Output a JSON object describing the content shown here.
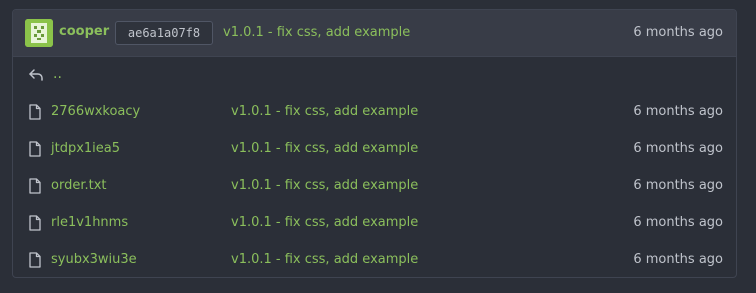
{
  "latest_commit": {
    "author": "cooper",
    "sha": "ae6a1a07f8",
    "message": "v1.0.1 - fix css, add example",
    "time": "6 months ago"
  },
  "parent_dir": {
    "label": "..",
    "icon": "back-arrow-icon"
  },
  "files": [
    {
      "name": "2766wxkoacy",
      "commit": "v1.0.1 - fix css, add example",
      "time": "6 months ago",
      "icon": "file-icon"
    },
    {
      "name": "jtdpx1iea5",
      "commit": "v1.0.1 - fix css, add example",
      "time": "6 months ago",
      "icon": "file-icon"
    },
    {
      "name": "order.txt",
      "commit": "v1.0.1 - fix css, add example",
      "time": "6 months ago",
      "icon": "file-icon"
    },
    {
      "name": "rle1v1hnms",
      "commit": "v1.0.1 - fix css, add example",
      "time": "6 months ago",
      "icon": "file-icon"
    },
    {
      "name": "syubx3wiu3e",
      "commit": "v1.0.1 - fix css, add example",
      "time": "6 months ago",
      "icon": "file-icon"
    }
  ],
  "colors": {
    "link": "#8bbf5c",
    "background": "#2b2f38",
    "header_background": "#383c47",
    "avatar": "#8bc34a"
  }
}
